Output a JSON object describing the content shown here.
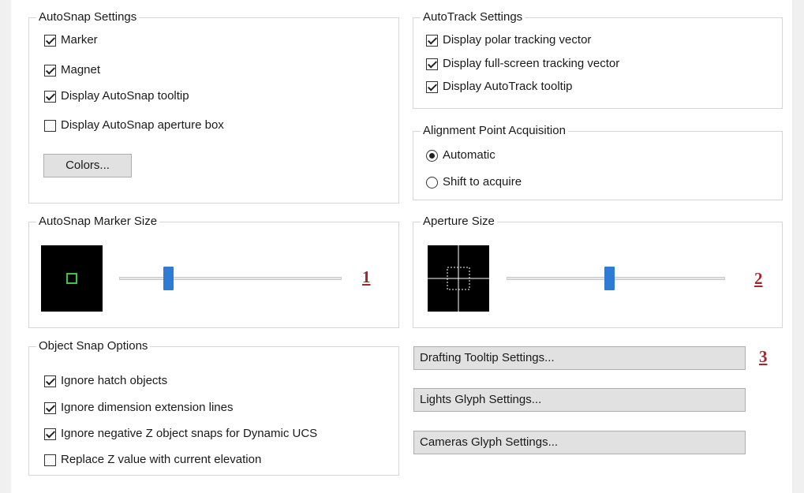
{
  "autosnap_settings": {
    "legend": "AutoSnap Settings",
    "items": [
      {
        "label": "Marker",
        "checked": true
      },
      {
        "label": "Magnet",
        "checked": true
      },
      {
        "label": "Display AutoSnap tooltip",
        "checked": true
      },
      {
        "label": "Display AutoSnap aperture box",
        "checked": false
      }
    ],
    "colors_button": "Colors..."
  },
  "autotrack_settings": {
    "legend": "AutoTrack Settings",
    "items": [
      {
        "label": "Display polar tracking vector",
        "checked": true
      },
      {
        "label": "Display full-screen tracking vector",
        "checked": true
      },
      {
        "label": "Display AutoTrack tooltip",
        "checked": true
      }
    ]
  },
  "alignment": {
    "legend": "Alignment Point Acquisition",
    "options": [
      {
        "label": "Automatic",
        "selected": true
      },
      {
        "label": "Shift to acquire",
        "selected": false
      }
    ]
  },
  "marker_size": {
    "legend": "AutoSnap Marker Size",
    "slider_fraction": 0.22,
    "marker_color": "#3ec24a",
    "annotation": "1"
  },
  "aperture_size": {
    "legend": "Aperture Size",
    "slider_fraction": 0.47,
    "annotation": "2"
  },
  "object_snap": {
    "legend": "Object Snap Options",
    "items": [
      {
        "label": "Ignore hatch objects",
        "checked": true
      },
      {
        "label": "Ignore dimension extension lines",
        "checked": true
      },
      {
        "label": "Ignore negative Z object snaps for Dynamic UCS",
        "checked": true
      },
      {
        "label": "Replace Z value with current elevation",
        "checked": false
      }
    ]
  },
  "buttons": {
    "drafting_tooltip": "Drafting Tooltip Settings...",
    "drafting_annotation": "3",
    "lights_glyph": "Lights Glyph Settings...",
    "cameras_glyph": "Cameras Glyph Settings..."
  },
  "colors": {
    "slider_thumb": "#2d7bd4",
    "annotation": "#a4262c"
  }
}
